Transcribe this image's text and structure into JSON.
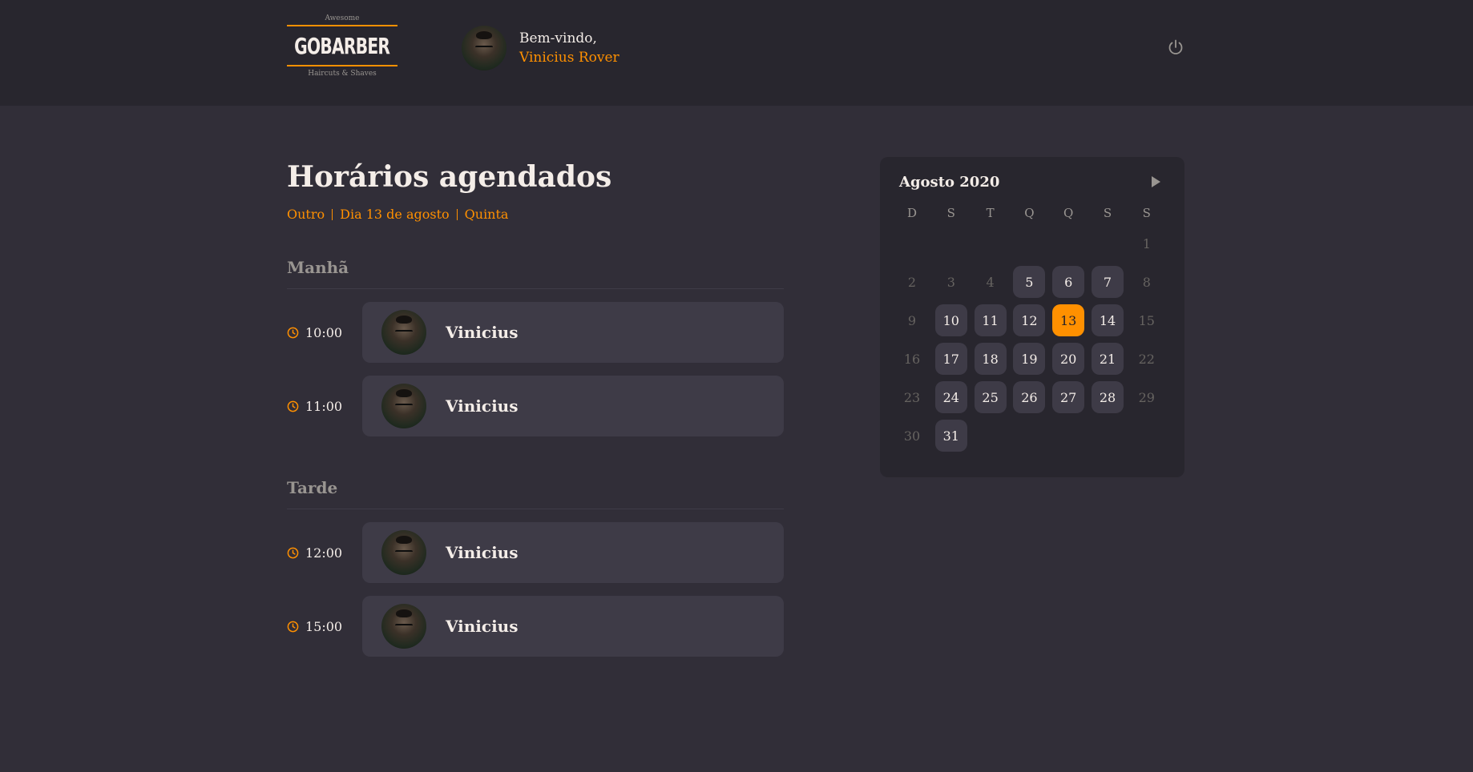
{
  "header": {
    "logo": {
      "top": "Awesome",
      "main": "GOBARBER",
      "bottom": "Haircuts & Shaves"
    },
    "welcome_label": "Bem-vindo,",
    "user_name": "Vinicius Rover",
    "power_icon": "power-icon"
  },
  "main": {
    "title": "Horários agendados",
    "subtitle": [
      "Outro",
      "Dia 13 de agosto",
      "Quinta"
    ],
    "sections": [
      {
        "title": "Manhã",
        "appointments": [
          {
            "time": "10:00",
            "name": "Vinicius"
          },
          {
            "time": "11:00",
            "name": "Vinicius"
          }
        ]
      },
      {
        "title": "Tarde",
        "appointments": [
          {
            "time": "12:00",
            "name": "Vinicius"
          },
          {
            "time": "15:00",
            "name": "Vinicius"
          }
        ]
      }
    ]
  },
  "calendar": {
    "month_label": "Agosto 2020",
    "weekdays": [
      "D",
      "S",
      "T",
      "Q",
      "Q",
      "S",
      "S"
    ],
    "first_weekday_index": 6,
    "days_in_month": 31,
    "available_days": [
      5,
      6,
      7,
      10,
      11,
      12,
      13,
      14,
      17,
      18,
      19,
      20,
      21,
      24,
      25,
      26,
      27,
      28,
      31
    ],
    "selected_day": 13
  },
  "colors": {
    "accent": "#ff9000",
    "background": "#312e38",
    "header": "#28262e",
    "card": "#3e3b47",
    "muted_text": "#999591"
  }
}
